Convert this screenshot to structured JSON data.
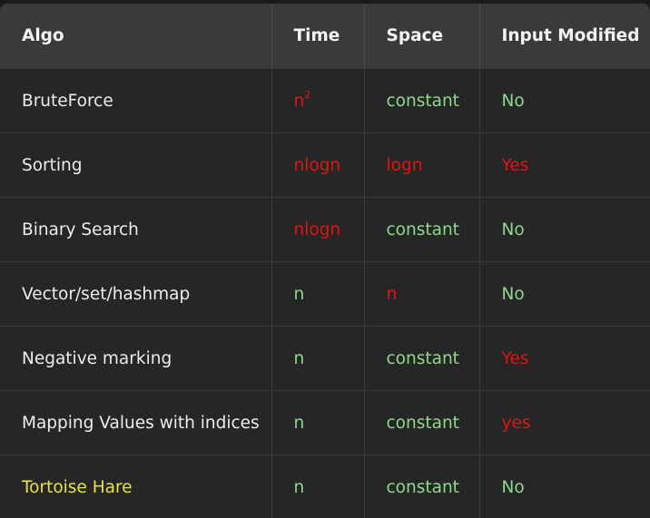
{
  "colors": {
    "green": "#8fd88a",
    "red": "#e01515",
    "yellow": "#e8e43a",
    "white": "#ececec"
  },
  "table": {
    "headers": [
      "Algo",
      "Time",
      "Space",
      "Input Modified"
    ],
    "rows": [
      {
        "algo": {
          "text": "BruteForce",
          "color": "white"
        },
        "time": {
          "text": "n",
          "sup": "2",
          "color": "red"
        },
        "space": {
          "text": "constant",
          "color": "green"
        },
        "input_modified": {
          "text": "No",
          "color": "green"
        }
      },
      {
        "algo": {
          "text": "Sorting",
          "color": "white"
        },
        "time": {
          "text": "nlogn",
          "color": "red"
        },
        "space": {
          "text": "logn",
          "color": "red"
        },
        "input_modified": {
          "text": "Yes",
          "color": "red"
        }
      },
      {
        "algo": {
          "text": "Binary Search",
          "color": "white"
        },
        "time": {
          "text": "nlogn",
          "color": "red"
        },
        "space": {
          "text": "constant",
          "color": "green"
        },
        "input_modified": {
          "text": "No",
          "color": "green"
        }
      },
      {
        "algo": {
          "text": "Vector/set/hashmap",
          "color": "white"
        },
        "time": {
          "text": "n",
          "color": "green"
        },
        "space": {
          "text": "n",
          "color": "red"
        },
        "input_modified": {
          "text": "No",
          "color": "green"
        }
      },
      {
        "algo": {
          "text": "Negative marking",
          "color": "white"
        },
        "time": {
          "text": "n",
          "color": "green"
        },
        "space": {
          "text": "constant",
          "color": "green"
        },
        "input_modified": {
          "text": "Yes",
          "color": "red"
        }
      },
      {
        "algo": {
          "text": "Mapping Values with indices",
          "color": "white"
        },
        "time": {
          "text": "n",
          "color": "green"
        },
        "space": {
          "text": "constant",
          "color": "green"
        },
        "input_modified": {
          "text": "yes",
          "color": "red"
        }
      },
      {
        "algo": {
          "text": "Tortoise Hare",
          "color": "yellow"
        },
        "time": {
          "text": "n",
          "color": "green"
        },
        "space": {
          "text": "constant",
          "color": "green"
        },
        "input_modified": {
          "text": "No",
          "color": "green"
        }
      }
    ]
  }
}
